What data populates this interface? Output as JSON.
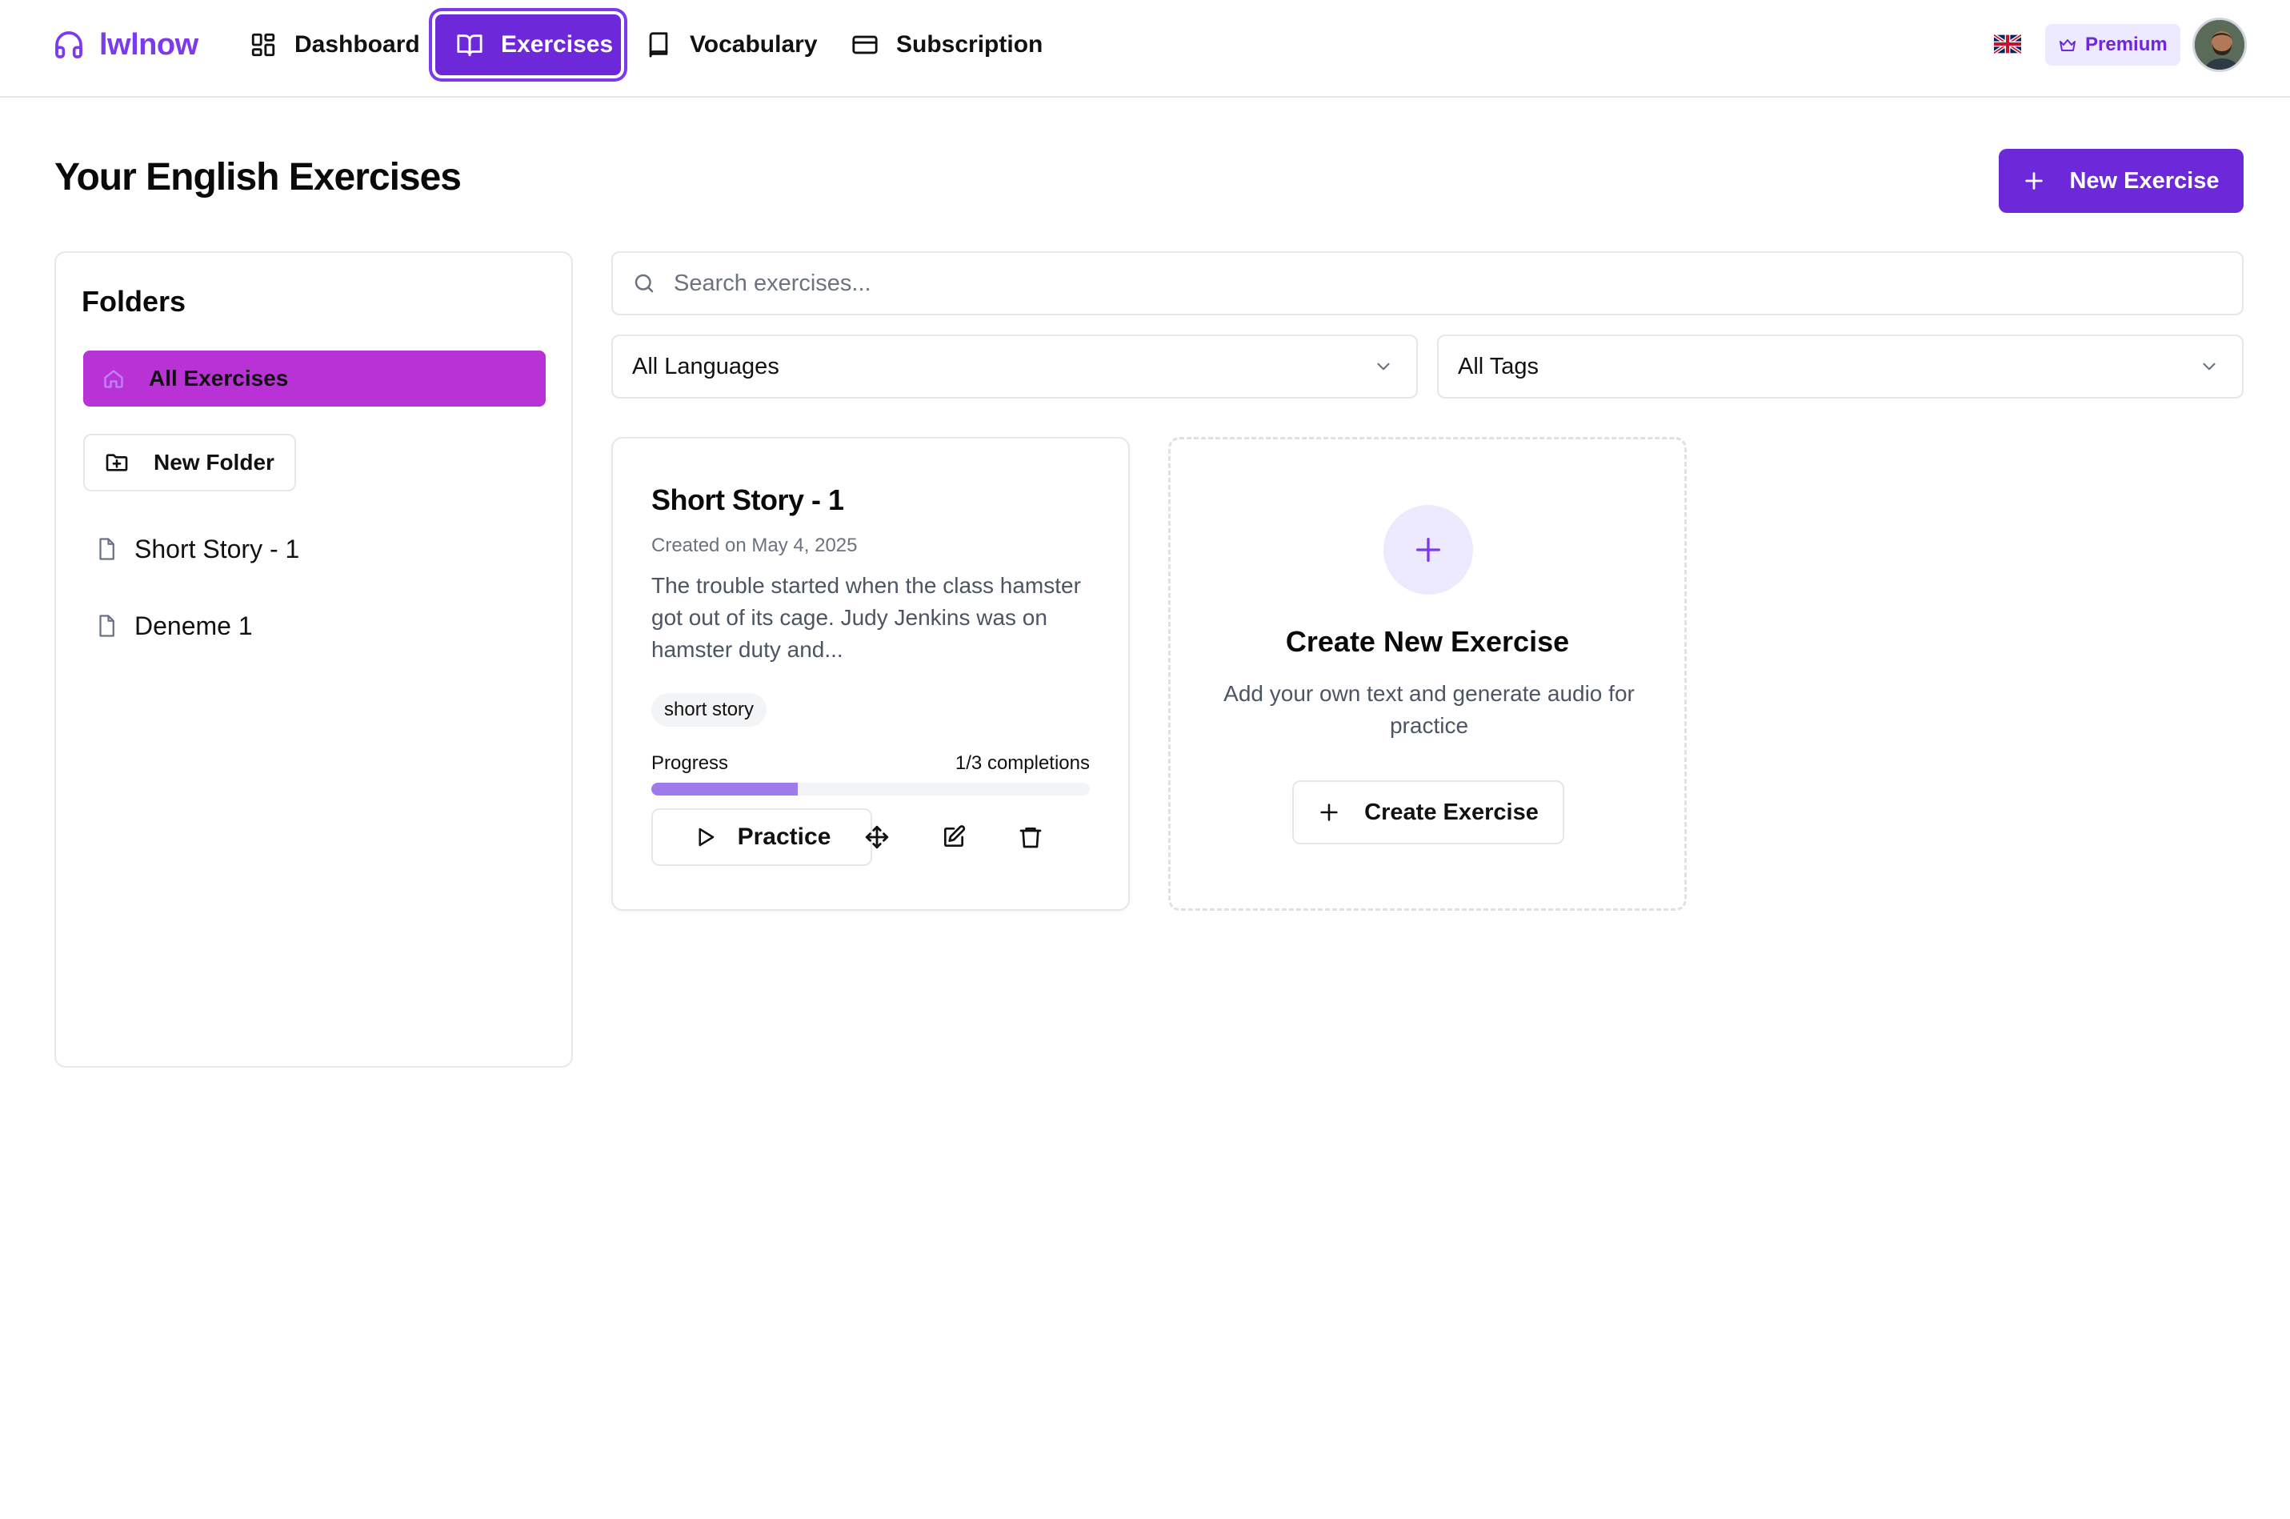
{
  "app": {
    "name": "lwlnow",
    "brand_color": "#7c3aed"
  },
  "nav": {
    "items": [
      {
        "label": "Dashboard",
        "icon": "dashboard-grid-icon",
        "active": false
      },
      {
        "label": "Exercises",
        "icon": "book-open-icon",
        "active": true
      },
      {
        "label": "Vocabulary",
        "icon": "book-icon",
        "active": false
      },
      {
        "label": "Subscription",
        "icon": "credit-card-icon",
        "active": false
      }
    ],
    "language_flag": "uk-flag-icon",
    "premium_label": "Premium"
  },
  "page": {
    "title": "Your English Exercises",
    "new_exercise_label": "New Exercise"
  },
  "folders": {
    "title": "Folders",
    "all_label": "All Exercises",
    "new_folder_label": "New Folder",
    "items": [
      {
        "label": "Short Story - 1"
      },
      {
        "label": "Deneme 1"
      }
    ]
  },
  "search": {
    "placeholder": "Search exercises..."
  },
  "filters": {
    "language": "All Languages",
    "tags": "All Tags"
  },
  "exercises": [
    {
      "title": "Short Story - 1",
      "created": "Created on May 4, 2025",
      "excerpt": "The trouble started when the class hamster got out of its cage. Judy Jenkins was on hamster duty and...",
      "tag": "short story",
      "progress_label": "Progress",
      "progress_text": "1/3 completions",
      "progress_fraction": 0.3333,
      "practice_label": "Practice"
    }
  ],
  "create_card": {
    "title": "Create New Exercise",
    "description": "Add your own text and generate audio for practice",
    "button_label": "Create Exercise"
  },
  "colors": {
    "accent": "#6d28d9",
    "folder_active": "#b832d6",
    "progress": "#9f7aea",
    "premium_bg": "#ede9fe"
  }
}
